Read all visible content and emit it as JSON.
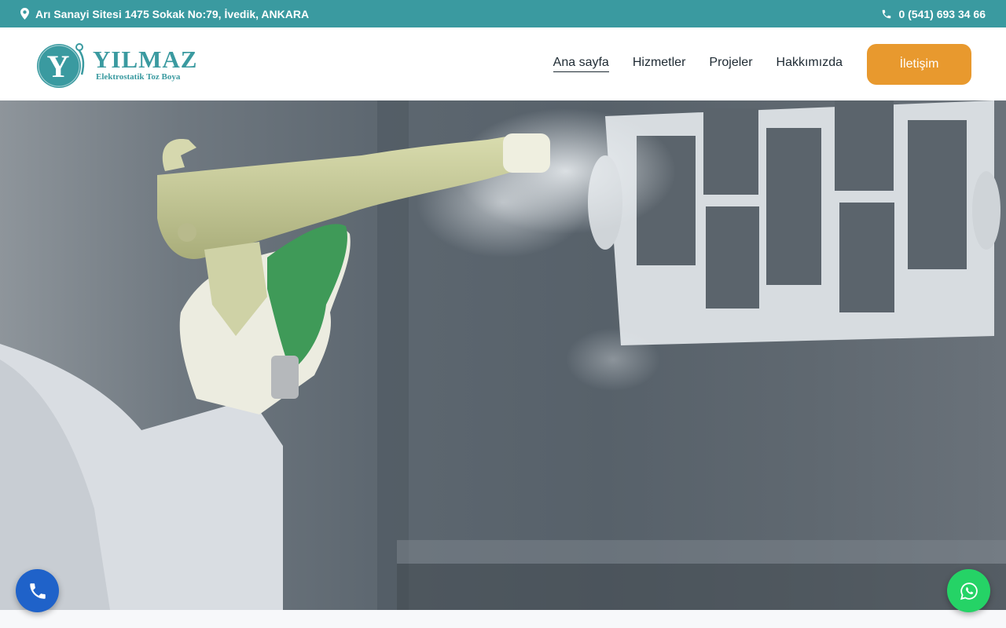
{
  "topbar": {
    "address": "Arı Sanayi Sitesi 1475 Sokak No:79, İvedik, ANKARA",
    "phone": "0 (541) 693 34 66",
    "address_icon": "map-marker-icon",
    "phone_icon": "phone-icon"
  },
  "logo": {
    "mark": "Y",
    "name": "YILMAZ",
    "tagline": "Elektrostatik Toz Boya"
  },
  "nav": {
    "items": [
      {
        "label": "Ana sayfa",
        "active": true
      },
      {
        "label": "Hizmetler",
        "active": false
      },
      {
        "label": "Projeler",
        "active": false
      },
      {
        "label": "Hakkımızda",
        "active": false
      }
    ],
    "cta_label": "İletişim"
  },
  "floating": {
    "call_icon": "phone-icon",
    "whatsapp_icon": "whatsapp-icon"
  },
  "colors": {
    "brand": "#3a9aa0",
    "accent": "#e8992e",
    "call_button": "#1f62c9",
    "whatsapp_button": "#25d366"
  }
}
